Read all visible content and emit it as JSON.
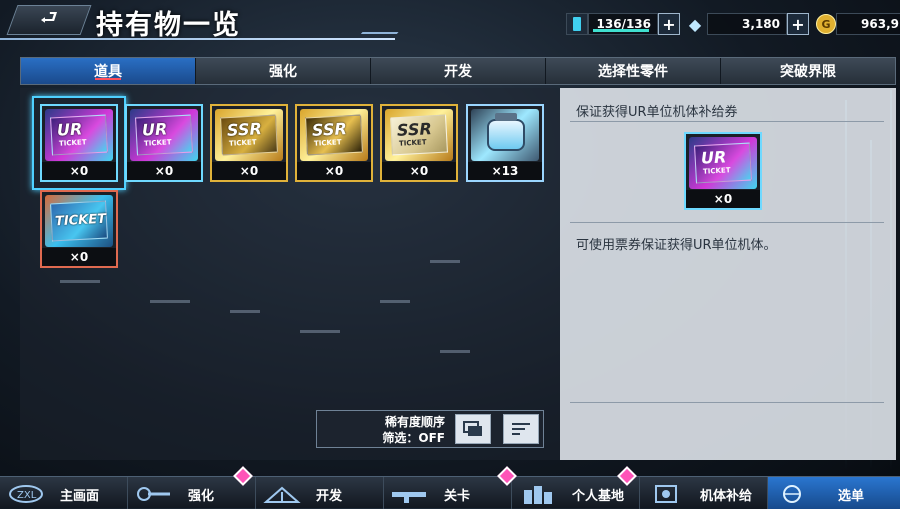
{
  "header": {
    "back_label": "⮐",
    "title": "持有物一览",
    "stamina": "136/136",
    "diamonds": "3,180",
    "coins": "963,9"
  },
  "tabs": [
    "道具",
    "强化",
    "开发",
    "选择性零件",
    "突破界限"
  ],
  "items": [
    {
      "label": "UR",
      "sub": "TICKET",
      "count": "×0",
      "rarity": "ur"
    },
    {
      "label": "UR",
      "sub": "TICKET",
      "count": "×0",
      "rarity": "ur"
    },
    {
      "label": "SSR",
      "sub": "TICKET",
      "count": "×0",
      "rarity": "ssr"
    },
    {
      "label": "SSR",
      "sub": "TICKET",
      "count": "×0",
      "rarity": "ssr"
    },
    {
      "label": "SSR",
      "sub": "TICKET",
      "count": "×0",
      "rarity": "ssr"
    },
    {
      "label": "",
      "sub": "",
      "count": "×13",
      "rarity": "sr"
    },
    {
      "label": "TICKET",
      "sub": "",
      "count": "×0",
      "rarity": "r"
    }
  ],
  "sort": {
    "label1": "稀有度顺序",
    "label2": "筛选：OFF"
  },
  "detail": {
    "title": "保证获得UR单位机体补给券",
    "item_label": "UR",
    "item_sub": "TICKET",
    "item_count": "×0",
    "description": "可使用票券保证获得UR单位机体。"
  },
  "nav": [
    "主画面",
    "强化",
    "开发",
    "关卡",
    "个人基地",
    "机体补给",
    "选单"
  ]
}
